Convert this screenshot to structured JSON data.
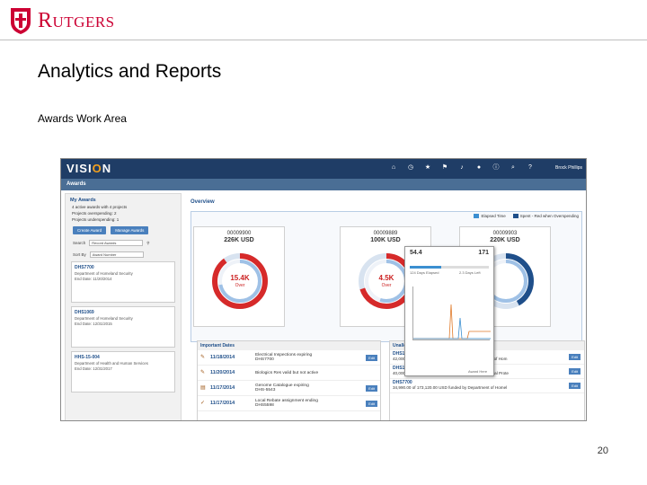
{
  "header": {
    "logo_text": "Rutgers"
  },
  "slide": {
    "title": "Analytics and Reports",
    "subtitle": "Awards Work Area",
    "page_number": "20"
  },
  "app": {
    "brand_prefix": "VISI",
    "brand_o": "O",
    "brand_suffix": "N",
    "user": "Brock Phillips",
    "section": "Awards",
    "icons": [
      "home-icon",
      "clock-icon",
      "star-icon",
      "flag-icon",
      "bell-icon",
      "chat-icon",
      "info-icon",
      "search-icon",
      "help-icon"
    ]
  },
  "sidebar": {
    "heading": "My Awards",
    "lines": [
      "4 active awards with 4 projects",
      "Projects overspending: 2",
      "Projects underspending: 1"
    ],
    "create_button": "Create Award",
    "manage_button": "Manage Awards",
    "search_label": "Search",
    "search_placeholder": "Record Awards",
    "sort_label": "Sort By",
    "sort_value": "Award Number",
    "cards": [
      {
        "id": "DHS7700",
        "dept": "Department of Homeland Security",
        "end": "End Date: 11/20/2014"
      },
      {
        "id": "DHS1069",
        "dept": "Department of Homeland Security",
        "end": "End Date: 12/31/2015"
      },
      {
        "id": "HHS-15-004",
        "dept": "Department of Health and Human Services",
        "end": "End Date: 12/31/2017"
      }
    ]
  },
  "overview": {
    "title": "Overview",
    "legend": [
      {
        "label": "Elapsed Time",
        "color": "#3b8fd1"
      },
      {
        "label": "Spent - Red when Overspending",
        "color": "#1f4f8a"
      }
    ],
    "awards": [
      {
        "id": "00009900",
        "amount": "226K USD",
        "value": "15.4K",
        "status": "Over",
        "elapsed": 0.72,
        "spent": 0.9,
        "over": true
      },
      {
        "id": "00009889",
        "amount": "100K USD",
        "value": "4.5K",
        "status": "Over",
        "elapsed": 0.55,
        "spent": 0.7,
        "over": true
      },
      {
        "id": "00009903",
        "amount": "220K USD",
        "value": "",
        "status": "",
        "elapsed": 0.85,
        "spent": 0.42,
        "over": false
      }
    ],
    "popup": {
      "value_left": "54.4",
      "value_right": "171",
      "elapsed_caption": "124 Days Elapsed",
      "right_caption": "2.3 Days Left",
      "bar_fill": 0.4,
      "footer": "Award Here"
    }
  },
  "important_dates": {
    "title": "Important Dates",
    "rows": [
      {
        "date": "11/18/2014",
        "text": "Electrical Inspections expiring",
        "sub": "DHS7700",
        "action": "Edit"
      },
      {
        "date": "11/20/2014",
        "text": "Biologics Res valid but not active",
        "sub": "",
        "action": ""
      },
      {
        "date": "11/17/2014",
        "text": "Genome Catalogue expiring",
        "sub": "DHS-5543",
        "action": "Edit"
      },
      {
        "date": "11/17/2014",
        "text": "Local Rebate assignment ending",
        "sub": "DHS5598",
        "action": "Edit"
      }
    ]
  },
  "funding": {
    "title": "Unallocated Funding Amount",
    "rows": [
      {
        "id": "DHS1069",
        "text": "42,000.00 of 1,219,000.00 USD funded by Department of Hom",
        "action": "Edit"
      },
      {
        "id": "DHS1034",
        "text": "40,000.00 of 2,467,000.00 USD funded by Environmental Prote",
        "action": "Edit"
      },
      {
        "id": "DHS7700",
        "text": "34,990.00 of 173,120.00 USD funded by Department of Homel",
        "action": "Edit"
      }
    ]
  }
}
